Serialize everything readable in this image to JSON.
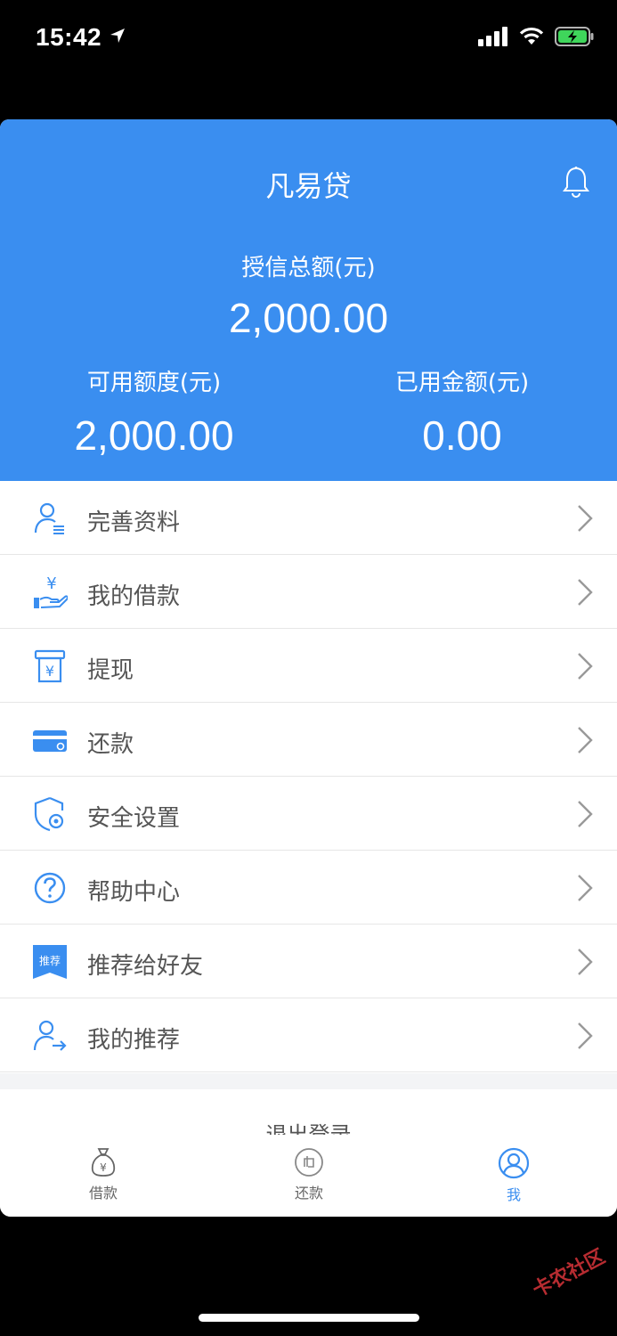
{
  "status_bar": {
    "time": "15:42"
  },
  "header": {
    "title": "凡易贷",
    "total_label": "授信总额(元)",
    "total_value": "2,000.00",
    "available_label": "可用额度(元)",
    "available_value": "2,000.00",
    "used_label": "已用金额(元)",
    "used_value": "0.00"
  },
  "menu": {
    "items": [
      {
        "label": "完善资料",
        "icon": "user-profile-icon"
      },
      {
        "label": "我的借款",
        "icon": "hand-yuan-icon"
      },
      {
        "label": "提现",
        "icon": "cash-withdraw-icon"
      },
      {
        "label": "还款",
        "icon": "card-icon"
      },
      {
        "label": "安全设置",
        "icon": "shield-gear-icon"
      },
      {
        "label": "帮助中心",
        "icon": "question-icon"
      },
      {
        "label": "推荐给好友",
        "icon": "recommend-bookmark-icon",
        "badge": "推荐"
      },
      {
        "label": "我的推荐",
        "icon": "user-share-icon"
      }
    ]
  },
  "logout_label": "退出登录",
  "tabbar": {
    "tabs": [
      {
        "label": "借款",
        "icon": "money-bag-icon"
      },
      {
        "label": "还款",
        "icon": "repay-icon"
      },
      {
        "label": "我",
        "icon": "user-circle-icon"
      }
    ]
  },
  "watermark": "卡农社区",
  "colors": {
    "accent": "#3a8ef0",
    "divider": "#e6e6e6",
    "text": "#555555"
  }
}
